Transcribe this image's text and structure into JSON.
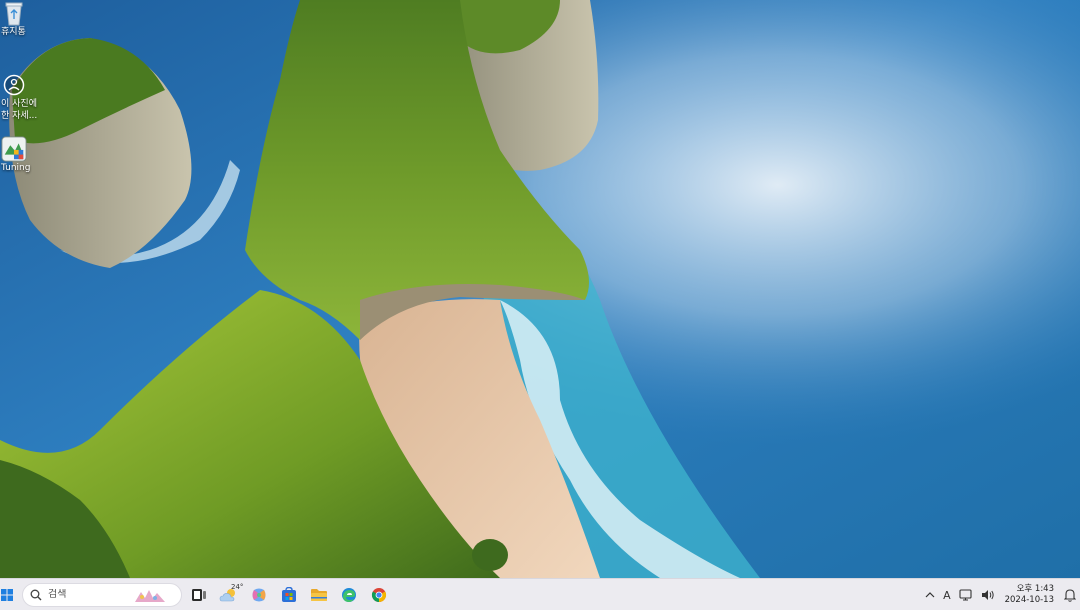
{
  "desktop": {
    "icons": [
      {
        "label": "휴지통",
        "icon": "recycle-bin-icon"
      },
      {
        "label": "이 사진에 대한 자세...",
        "label_line1": "이 사진에",
        "label_line2": "한 자세...",
        "icon": "spotlight-info-icon"
      },
      {
        "label": "Tuning",
        "icon": "tuning-app-icon"
      }
    ]
  },
  "taskbar": {
    "search": {
      "placeholder": "검색",
      "icon": "search-icon"
    },
    "weather": {
      "temp": "24°"
    },
    "apps": [
      {
        "name": "start",
        "icon": "windows-start-icon"
      },
      {
        "name": "task-view",
        "icon": "task-view-icon"
      },
      {
        "name": "weather",
        "icon": "weather-icon"
      },
      {
        "name": "copilot",
        "icon": "copilot-icon"
      },
      {
        "name": "store",
        "icon": "store-icon"
      },
      {
        "name": "file-explorer",
        "icon": "folder-icon"
      },
      {
        "name": "edge",
        "icon": "edge-icon"
      },
      {
        "name": "chrome",
        "icon": "chrome-icon"
      }
    ],
    "tray": {
      "chevron": "^",
      "ime": "A",
      "clock_line1": "오후 1:43",
      "clock_line2": "2024-10-13"
    }
  },
  "colors": {
    "taskbar_bg": "#ecebf0",
    "sea": "#1a6aa5",
    "cliff_green": "#7da52a",
    "sand": "#e8c9a6"
  }
}
